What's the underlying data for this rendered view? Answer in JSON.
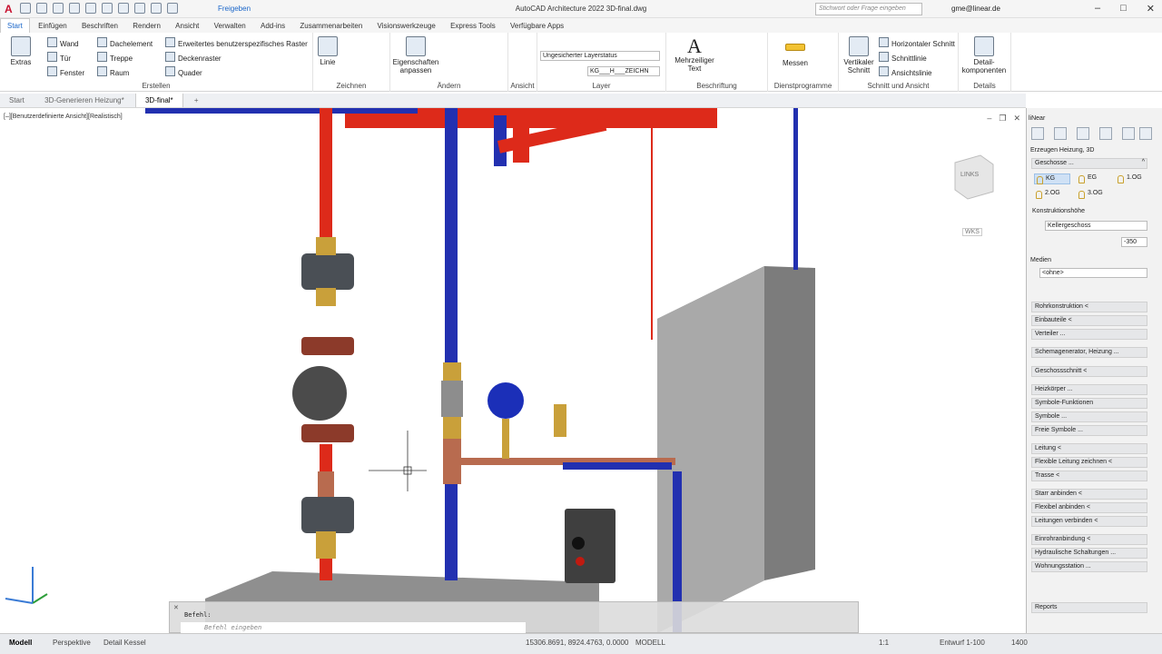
{
  "titlebar": {
    "logo": "A",
    "app_title": "AutoCAD Architecture 2022   3D-final.dwg",
    "share": "Freigeben",
    "search_placeholder": "Stichwort oder Frage eingeben",
    "user": "gme@linear.de"
  },
  "ribbon_tabs": [
    "Start",
    "Einfügen",
    "Beschriften",
    "Rendern",
    "Ansicht",
    "Verwalten",
    "Add-ins",
    "Zusammenarbeiten",
    "Visionswerkzeuge",
    "Express Tools",
    "Verfügbare Apps"
  ],
  "ribbon": {
    "erstellen": {
      "label": "Erstellen",
      "extras": "Extras",
      "wand": "Wand",
      "tuer": "Tür",
      "fenster": "Fenster",
      "dachelement": "Dachelement",
      "treppe": "Treppe",
      "raum": "Raum",
      "raster": "Erweitertes benutzerspezifisches Raster",
      "deckenraster": "Deckenraster",
      "quader": "Quader"
    },
    "zeichnen": {
      "label": "Zeichnen",
      "linie": "Linie"
    },
    "aendern": {
      "label": "Ändern",
      "eigenschaften": "Eigenschaften anpassen"
    },
    "ansicht": {
      "label": "Ansicht"
    },
    "layer": {
      "label": "Layer",
      "status": "Ungesicherter Layerstatus",
      "current": "KG___H___ZEICHN"
    },
    "beschriftung": {
      "label": "Beschriftung",
      "text": "Mehrzeiliger Text"
    },
    "dienst": {
      "label": "Dienstprogramme",
      "messen": "Messen"
    },
    "schnitt": {
      "label": "Schnitt und Ansicht",
      "vertikal": "Vertikaler Schnitt",
      "horizontal": "Horizontaler Schnitt",
      "schnittlinie": "Schnittlinie",
      "ansichtslinie": "Ansichtslinie"
    },
    "details": {
      "label": "Details",
      "detail": "Detail-komponenten"
    }
  },
  "doc_tabs": [
    "Start",
    "3D-Generieren Heizung*",
    "3D-final*"
  ],
  "viewport": {
    "label": "[–][Benutzerdefinierte Ansicht][Realistisch]",
    "viewcube": "LINKS",
    "wcs": "WKS"
  },
  "command": {
    "history": "Befehl:",
    "placeholder": "Befehl eingeben"
  },
  "status": {
    "tabs": [
      "Modell",
      "Perspektive",
      "Detail Kessel"
    ],
    "coords": "15306.8691, 8924.4763, 0.0000",
    "mode": "MODELL",
    "scale": "1:1",
    "style": "Entwurf 1-100",
    "zoom": "1400"
  },
  "panel": {
    "title": "liNear",
    "subtitle": "Erzeugen Heizung, 3D",
    "geschosse": "Geschosse ...",
    "floors": [
      "KG",
      "EG",
      "1.OG",
      "2.OG",
      "3.OG"
    ],
    "konstr": "Konstruktionshöhe",
    "keller": "Kellergeschoss",
    "value": "-350",
    "medien": "Medien",
    "ohne": "<ohne>",
    "items": [
      "Rohrkonstruktion <",
      "Einbauteile <",
      "Verteiler ...",
      "Schemagenerator, Heizung ...",
      "Geschossschnitt <",
      "Heizkörper ...",
      "Symbole-Funktionen",
      "Symbole ...",
      "Freie Symbole ...",
      "Leitung <",
      "Flexible Leitung zeichnen <",
      "Trasse <",
      "Starr anbinden <",
      "Flexibel anbinden <",
      "Leitungen verbinden <",
      "Einrohranbindung <",
      "Hydraulische Schaltungen ...",
      "Wohnungsstation ..."
    ],
    "reports": "Reports"
  }
}
